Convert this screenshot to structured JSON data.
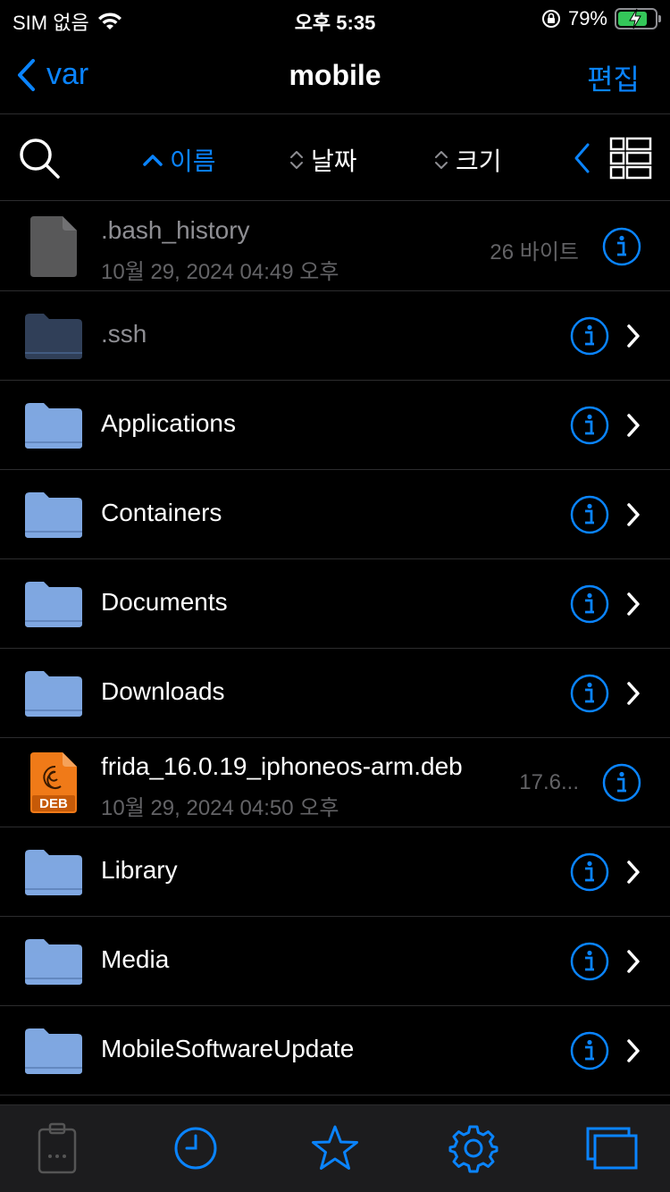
{
  "status_bar": {
    "carrier": "SIM 없음",
    "time": "오후 5:35",
    "battery_percent": "79%",
    "battery_level": 0.79
  },
  "navbar": {
    "back_label": "var",
    "title": "mobile",
    "edit_label": "편집"
  },
  "sort_bar": {
    "name_label": "이름",
    "date_label": "날짜",
    "size_label": "크기"
  },
  "files": [
    {
      "name": ".bash_history",
      "date": "10월 29, 2024 04:49 오후",
      "size": "26 바이트",
      "type": "file",
      "dim": true
    },
    {
      "name": ".ssh",
      "type": "folder",
      "dim": true
    },
    {
      "name": "Applications",
      "type": "folder"
    },
    {
      "name": "Containers",
      "type": "folder"
    },
    {
      "name": "Documents",
      "type": "folder"
    },
    {
      "name": "Downloads",
      "type": "folder"
    },
    {
      "name": "frida_16.0.19_iphoneos-arm.deb",
      "date": "10월 29, 2024 04:50 오후",
      "size": "17.6...",
      "type": "deb",
      "badge": "DEB"
    },
    {
      "name": "Library",
      "type": "folder"
    },
    {
      "name": "Media",
      "type": "folder"
    },
    {
      "name": "MobileSoftwareUpdate",
      "type": "folder"
    }
  ],
  "tabbar": {
    "items": [
      {
        "icon": "clipboard-icon",
        "active": false
      },
      {
        "icon": "clock-icon",
        "active": true
      },
      {
        "icon": "star-icon",
        "active": true
      },
      {
        "icon": "gear-icon",
        "active": true
      },
      {
        "icon": "windows-icon",
        "active": true
      }
    ]
  },
  "colors": {
    "accent": "#0a84ff",
    "background": "#000000",
    "separator": "#2c2c2e",
    "secondary_text": "#636366",
    "folder": "#7fa7e0",
    "folder_dim": "#3d4f6e",
    "deb": "#f07a18"
  }
}
